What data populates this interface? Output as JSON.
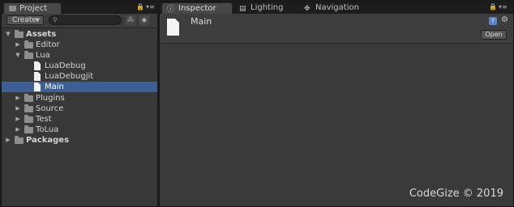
{
  "project_panel": {
    "tab_label": "Project",
    "create_label": "Create",
    "search_placeholder": "",
    "tree": [
      {
        "label": "Assets",
        "type": "folder",
        "expanded": true,
        "bold": true
      },
      {
        "label": "Editor",
        "type": "folder",
        "expanded": false
      },
      {
        "label": "Lua",
        "type": "folder",
        "expanded": true
      },
      {
        "label": "LuaDebug",
        "type": "file"
      },
      {
        "label": "LuaDebugjit",
        "type": "file"
      },
      {
        "label": "Main",
        "type": "file",
        "selected": true
      },
      {
        "label": "Plugins",
        "type": "folder",
        "expanded": false
      },
      {
        "label": "Source",
        "type": "folder",
        "expanded": false
      },
      {
        "label": "Test",
        "type": "folder",
        "expanded": false
      },
      {
        "label": "ToLua",
        "type": "folder",
        "expanded": false
      },
      {
        "label": "Packages",
        "type": "folder",
        "expanded": false,
        "bold": true
      }
    ]
  },
  "inspector_panel": {
    "tabs": [
      "Inspector",
      "Lighting",
      "Navigation"
    ],
    "active_tab": "Inspector",
    "asset_name": "Main",
    "open_label": "Open"
  },
  "watermark": "CodeGize © 2019",
  "colors": {
    "selection": "#3e5f96",
    "panel_bg": "#383838",
    "tab_bg": "#1d1d1d"
  }
}
